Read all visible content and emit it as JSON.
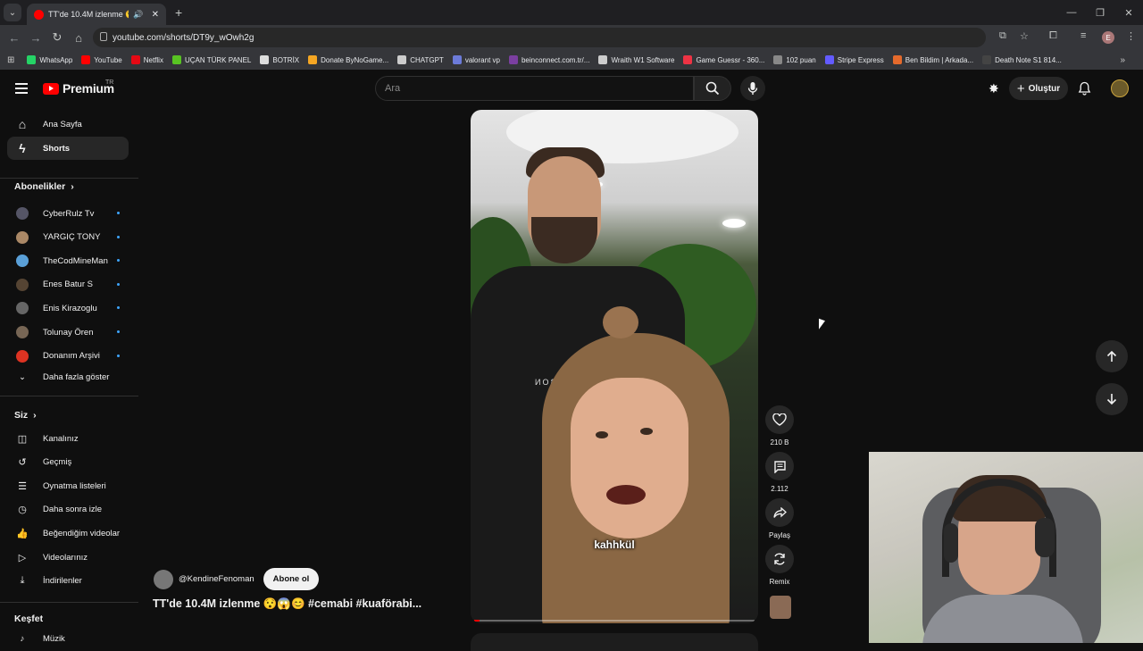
{
  "browser": {
    "tab_title": "TT'de 10.4M izlenme 😯😱",
    "url": "youtube.com/shorts/DT9y_wOwh2g",
    "bookmarks": [
      {
        "label": "WhatsApp",
        "color": "#25d366"
      },
      {
        "label": "YouTube",
        "color": "#ff0000"
      },
      {
        "label": "Netflix",
        "color": "#e50914"
      },
      {
        "label": "UÇAN TÜRK PANEL",
        "color": "#58c322"
      },
      {
        "label": "BOTRİX",
        "color": "#dddddd"
      },
      {
        "label": "Donate ByNoGame...",
        "color": "#f5a623"
      },
      {
        "label": "CHATGPT",
        "color": "#cccccc"
      },
      {
        "label": "valorant vp",
        "color": "#6c7bd9"
      },
      {
        "label": "beinconnect.com.tr/...",
        "color": "#7b3fa0"
      },
      {
        "label": "Wraith W1 Software",
        "color": "#cccccc"
      },
      {
        "label": "Game Guessr - 360...",
        "color": "#e34"
      },
      {
        "label": "102 puan",
        "color": "#888888"
      },
      {
        "label": "Stripe Express",
        "color": "#635bff"
      },
      {
        "label": "Ben Bildim | Arkada...",
        "color": "#e56a2c"
      },
      {
        "label": "Death Note S1 814...",
        "color": "#444444"
      }
    ],
    "profile_initial": "E"
  },
  "header": {
    "logo_text": "Premium",
    "region": "TR",
    "search_placeholder": "Ara",
    "create_label": "Oluştur"
  },
  "sidebar": {
    "main": [
      {
        "label": "Ana Sayfa",
        "active": false
      },
      {
        "label": "Shorts",
        "active": true
      }
    ],
    "subs_heading": "Abonelikler",
    "channels": [
      {
        "label": "CyberRulz Tv",
        "color": "#556"
      },
      {
        "label": "YARGIÇ TONY",
        "color": "#a86"
      },
      {
        "label": "TheCodMineMan",
        "color": "#5aa0d8"
      },
      {
        "label": "Enes Batur S",
        "color": "#543"
      },
      {
        "label": "Enis Kirazoglu",
        "color": "#666"
      },
      {
        "label": "Tolunay Ören",
        "color": "#765"
      },
      {
        "label": "Donanım Arşivi",
        "color": "#d32"
      }
    ],
    "show_more": "Daha fazla göster",
    "you_heading": "Siz",
    "you_items": [
      "Kanalınız",
      "Geçmiş",
      "Oynatma listeleri",
      "Daha sonra izle",
      "Beğendiğim videolar",
      "Videolarınız",
      "İndirilenler"
    ],
    "explore_heading": "Keşfet",
    "explore_first": "Müzik"
  },
  "short": {
    "caption": "kahhkül",
    "apron_text": "TONE BON",
    "channel": "@KendineFenoman",
    "subscribe_label": "Abone ol",
    "title": "TT'de 10.4M izlenme 😯😱😊 #cemabi #kuaförabi...",
    "progress": 0.02,
    "actions": {
      "likes": "210 B",
      "comments": "2.112",
      "share": "Paylaş",
      "remix": "Remix"
    }
  }
}
